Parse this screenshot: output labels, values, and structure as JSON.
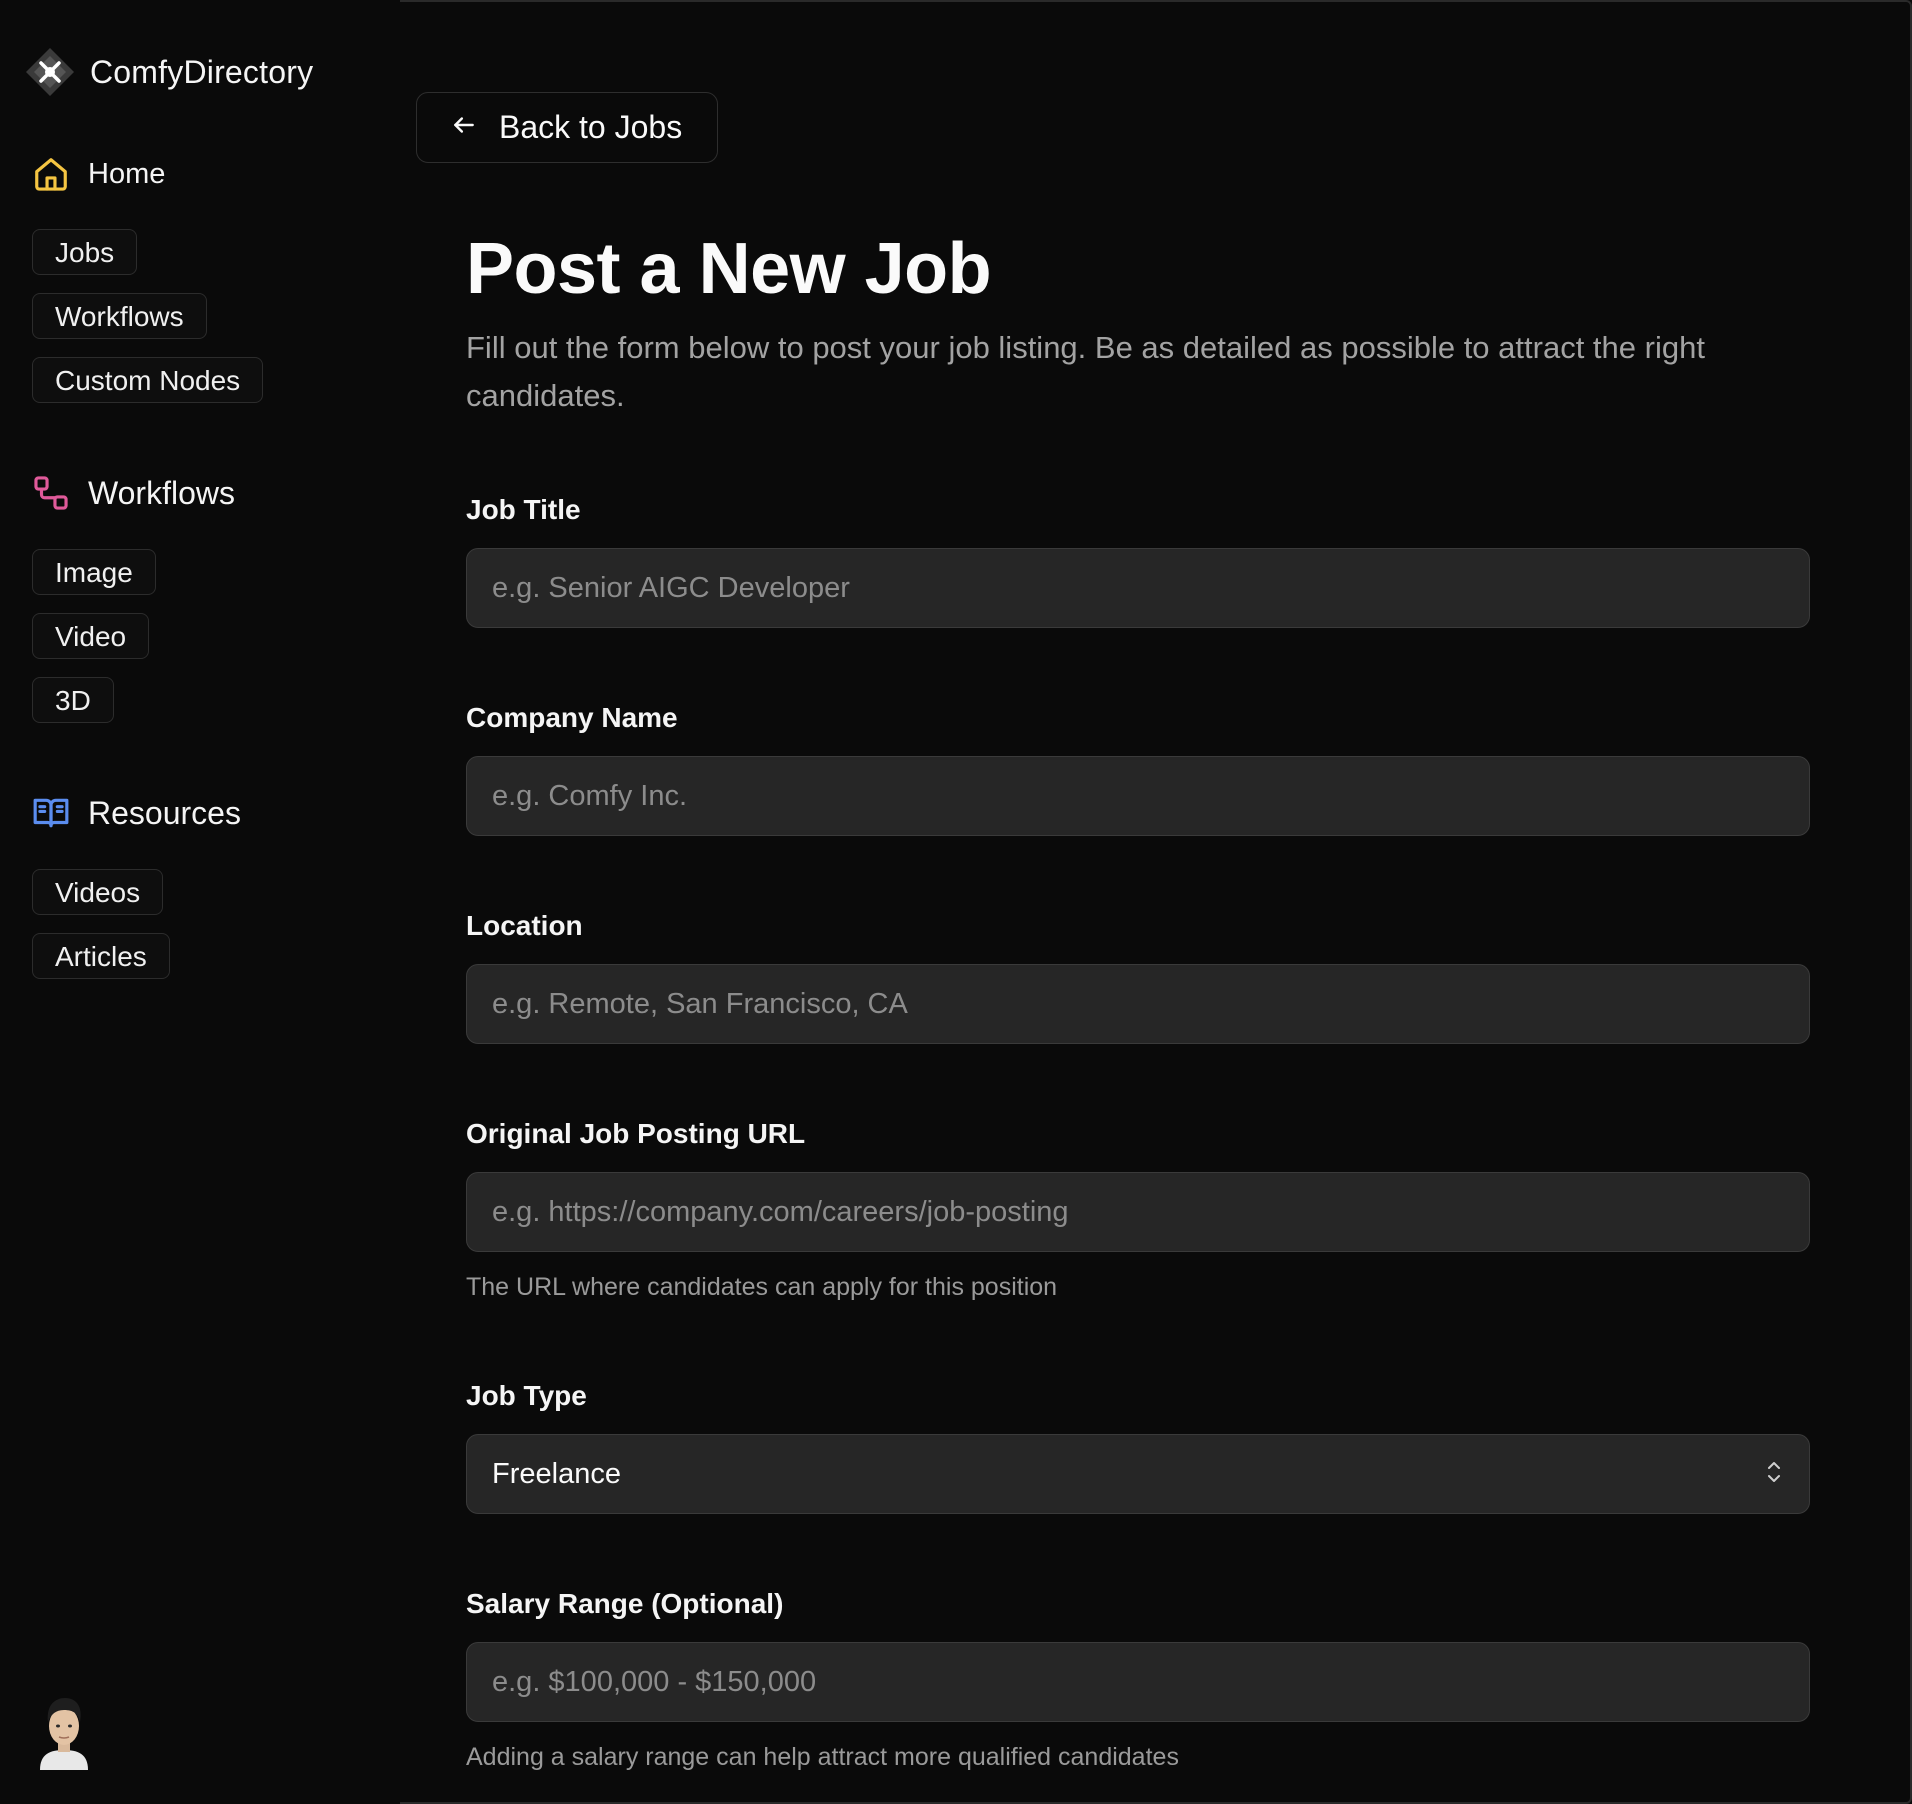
{
  "brand": {
    "name": "ComfyDirectory"
  },
  "sidebar": {
    "home": {
      "label": "Home",
      "icon": "home-icon",
      "color": "#f5c542"
    },
    "home_items": [
      "Jobs",
      "Workflows",
      "Custom Nodes"
    ],
    "workflows": {
      "label": "Workflows",
      "icon": "workflow-icon",
      "color": "#e05a9a"
    },
    "workflow_items": [
      "Image",
      "Video",
      "3D"
    ],
    "resources": {
      "label": "Resources",
      "icon": "book-open-icon",
      "color": "#5b8def"
    },
    "resource_items": [
      "Videos",
      "Articles"
    ]
  },
  "main": {
    "back_button": "Back to Jobs",
    "title": "Post a New Job",
    "description": "Fill out the form below to post your job listing. Be as detailed as possible to attract the right candidates.",
    "fields": {
      "job_title": {
        "label": "Job Title",
        "placeholder": "e.g. Senior AIGC Developer"
      },
      "company_name": {
        "label": "Company Name",
        "placeholder": "e.g. Comfy Inc."
      },
      "location": {
        "label": "Location",
        "placeholder": "e.g. Remote, San Francisco, CA"
      },
      "url": {
        "label": "Original Job Posting URL",
        "placeholder": "e.g. https://company.com/careers/job-posting",
        "hint": "The URL where candidates can apply for this position"
      },
      "job_type": {
        "label": "Job Type",
        "value": "Freelance"
      },
      "salary": {
        "label": "Salary Range (Optional)",
        "placeholder": "e.g. $100,000 - $150,000",
        "hint": "Adding a salary range can help attract more qualified candidates"
      }
    }
  }
}
